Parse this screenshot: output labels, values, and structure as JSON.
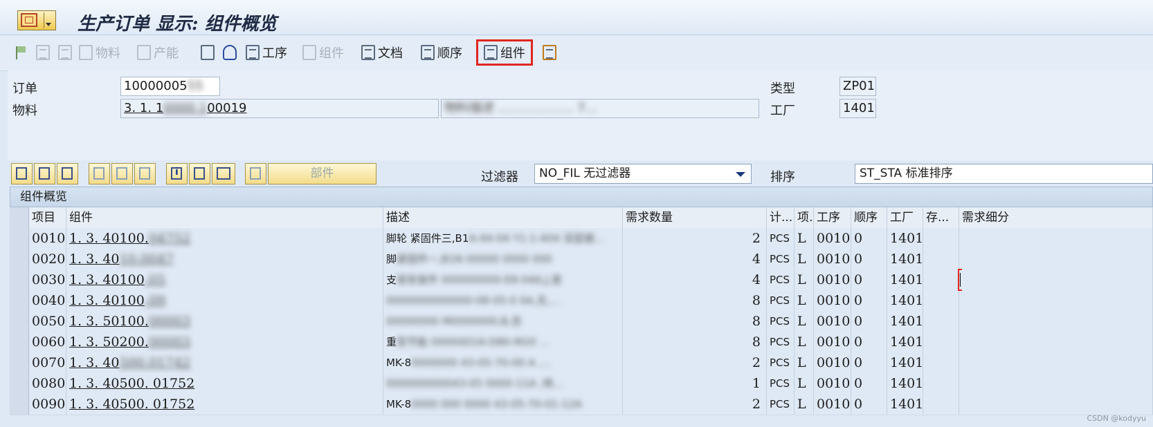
{
  "window": {
    "title": "生产订单 显示: 组件概览"
  },
  "toolbar": {
    "items": [
      {
        "label": "",
        "icon": "flag-icon",
        "enabled": false
      },
      {
        "label": "",
        "icon": "document-icon",
        "enabled": false
      },
      {
        "label": "",
        "icon": "calculator-icon",
        "enabled": false
      },
      {
        "label": "物料",
        "icon": "material-icon",
        "enabled": false
      },
      {
        "label": "产能",
        "icon": "capacity-icon",
        "enabled": false
      },
      {
        "label": "",
        "icon": "hierarchy-icon",
        "enabled": true
      },
      {
        "label": "",
        "icon": "bowl-icon",
        "enabled": true
      },
      {
        "label": "工序",
        "icon": "operation-icon",
        "enabled": true
      },
      {
        "label": "组件",
        "icon": "component-icon",
        "enabled": false
      },
      {
        "label": "文档",
        "icon": "document-icon",
        "enabled": true
      },
      {
        "label": "顺序",
        "icon": "sequence-icon",
        "enabled": true
      },
      {
        "label": "组件",
        "icon": "list-icon",
        "enabled": true,
        "highlighted": true
      },
      {
        "label": "",
        "icon": "tree-icon",
        "enabled": true
      }
    ]
  },
  "header": {
    "order_label": "订单",
    "order_value": "10000005",
    "material_label": "物料",
    "material_value": "3. 1. 1",
    "material_value_end": "00019",
    "material_desc": "物料描述 ................... 7...",
    "type_label": "类型",
    "type_value": "ZP01",
    "plant_label": "工厂",
    "plant_value": "1401"
  },
  "subtoolbar": {
    "parts_label": "部件",
    "filter_label": "过滤器",
    "filter_value": "NO_FIL 无过滤器",
    "sort_label": "排序",
    "sort_value": "ST_STA 标准排序"
  },
  "table": {
    "title": "组件概览",
    "columns": [
      "项目",
      "组件",
      "描述",
      "需求数量",
      "计...",
      "项.",
      "工序",
      "顺序",
      "工厂",
      "存...",
      "需求细分"
    ],
    "rows": [
      {
        "item": "0010",
        "component": "1. 3. 40100.",
        "component_blur": "04752",
        "desc": "脚轮 紧固件三,B1",
        "desc_blur": "A-44-04 Y1-1-404 深蓝镀...",
        "qty": "2",
        "unit": "PCS",
        "cat": "L",
        "op": "0010",
        "seq": "0",
        "plant": "1401"
      },
      {
        "item": "0020",
        "component": "1. 3. 40",
        "component_blur": "10.0047",
        "desc": "脚",
        "desc_blur": "紧固件一,B1N 00000 0000 000",
        "qty": "4",
        "unit": "PCS",
        "cat": "L",
        "op": "0010",
        "seq": "0",
        "plant": "1401"
      },
      {
        "item": "0030",
        "component": "1. 3. 40100",
        "component_blur": ".05",
        "desc": "支",
        "desc_blur": "架安装件 000000000-E8-04A,J,是",
        "qty": "4",
        "unit": "PCS",
        "cat": "L",
        "op": "0010",
        "seq": "0",
        "plant": "1401"
      },
      {
        "item": "0040",
        "component": "1. 3. 40100",
        "component_blur": ".09",
        "desc": "",
        "desc_blur": "0000000000000-08-05-0 0A,无,...",
        "qty": "8",
        "unit": "PCS",
        "cat": "L",
        "op": "0010",
        "seq": "0",
        "plant": "1401"
      },
      {
        "item": "0050",
        "component": "1. 3. 50100.",
        "component_blur": "00003",
        "desc": "",
        "desc_blur": "00000000 M0000000,B,否",
        "qty": "8",
        "unit": "PCS",
        "cat": "L",
        "op": "0010",
        "seq": "0",
        "plant": "1401"
      },
      {
        "item": "0060",
        "component": "1. 3. 50200.",
        "component_blur": "00003",
        "desc": "重",
        "desc_blur": "型节能 00000D16-D80-M20 ...",
        "qty": "8",
        "unit": "PCS",
        "cat": "L",
        "op": "0010",
        "seq": "0",
        "plant": "1401"
      },
      {
        "item": "0070",
        "component": "1. 3. 40",
        "component_blur": "500.01742",
        "desc": "MK-8",
        "desc_blur": "0000000 43-05-70-00 A ,...",
        "qty": "2",
        "unit": "PCS",
        "cat": "L",
        "op": "0010",
        "seq": "0",
        "plant": "1401"
      },
      {
        "item": "0080",
        "component": "1. 3. 40500. 01752",
        "component_blur": "",
        "desc": "",
        "desc_blur": "000000000043-05 0000-11A ,喷...",
        "qty": "1",
        "unit": "PCS",
        "cat": "L",
        "op": "0010",
        "seq": "0",
        "plant": "1401"
      },
      {
        "item": "0090",
        "component": "1. 3. 40500. 01752",
        "component_blur": "",
        "desc": "MK-8",
        "desc_blur": "0000 000 0000 43-05-70-01-12A",
        "qty": "2",
        "unit": "PCS",
        "cat": "L",
        "op": "0010",
        "seq": "0",
        "plant": "1401"
      }
    ]
  },
  "watermark": "CSDN @kodyyu"
}
